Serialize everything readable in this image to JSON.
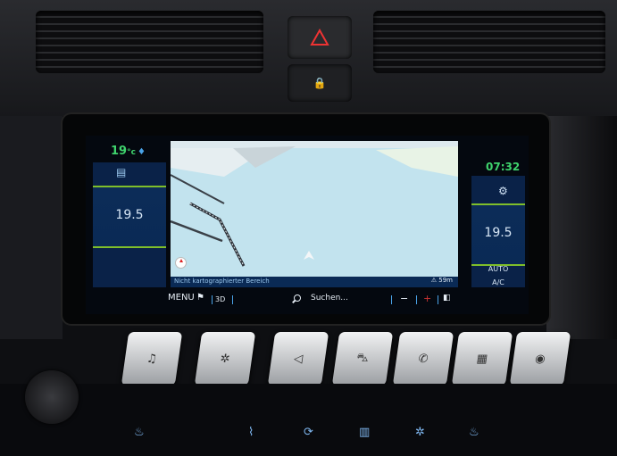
{
  "climate": {
    "outside_temp": "19",
    "outside_unit": "°c",
    "left_temp": "19.5",
    "right_temp": "19.5",
    "auto_label": "AUTO",
    "ac_label": "A/C"
  },
  "clock": "07:32",
  "map": {
    "status_text": "Nicht kartographierter Bereich",
    "distance": "59m"
  },
  "toolbar": {
    "menu_label": "MENU",
    "view_3d": "3D",
    "search_label": "Suchen..."
  },
  "icons": {
    "fan": "fan-icon",
    "gear": "gear-icon",
    "location": "location-pin-icon",
    "flag": "checkered-flag-icon",
    "search": "search-icon",
    "compass": "compass-icon"
  },
  "colors": {
    "clock_green": "#3fd36d",
    "panel_blue": "#0a2a55",
    "accent_blue": "#4aa3e8",
    "map_water": "#c2e3ee"
  }
}
